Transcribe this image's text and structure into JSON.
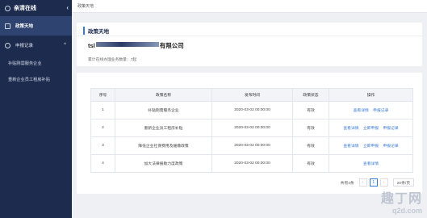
{
  "sidebar": {
    "brand": "亲清在线",
    "collapse_icon": "‹",
    "items": [
      {
        "label": "政策天地",
        "active": true
      },
      {
        "label": "申报记录",
        "arrow": "^"
      }
    ],
    "sub_items": [
      {
        "label": "补贴刚需服务企业"
      },
      {
        "label": "重新企业员工租房补贴"
      }
    ]
  },
  "topbar": {
    "tab": "政策天地"
  },
  "header_panel": {
    "title": "政策天地",
    "company_prefix": "tsl",
    "company_suffix": "有限公司",
    "count_text": "累计在线办理业务数量：7起"
  },
  "table": {
    "columns": [
      "序号",
      "政策名称",
      "发布时间",
      "政策状态",
      "操作"
    ],
    "rows": [
      {
        "no": "1",
        "name": "补贴刚需服务企业",
        "time": "2020-03-02 00:00:00",
        "status": "有效",
        "actions": [
          "查看详情",
          "申报记录"
        ]
      },
      {
        "no": "2",
        "name": "重新企业员工租房补贴",
        "time": "2020-03-02 00:00:00",
        "status": "有效",
        "actions": [
          "查看详情",
          "立即申报",
          "申报记录"
        ]
      },
      {
        "no": "3",
        "name": "降低企业社保费用及缓缴政策",
        "time": "2020-03-02 00:00:00",
        "status": "有效",
        "actions": [
          "查看详情",
          "立即申报",
          "申报记录"
        ]
      },
      {
        "no": "4",
        "name": "加大法律援助力度政策",
        "time": "2020-03-02 00:00:00",
        "status": "有效",
        "actions": [
          "查看详情"
        ]
      }
    ]
  },
  "pagination": {
    "total": "共有4条",
    "prev": "‹",
    "current_page": "1",
    "next": "›",
    "page_size": "20条/页"
  },
  "watermark": {
    "cn": "趣丁网",
    "en": "q2d.com"
  }
}
